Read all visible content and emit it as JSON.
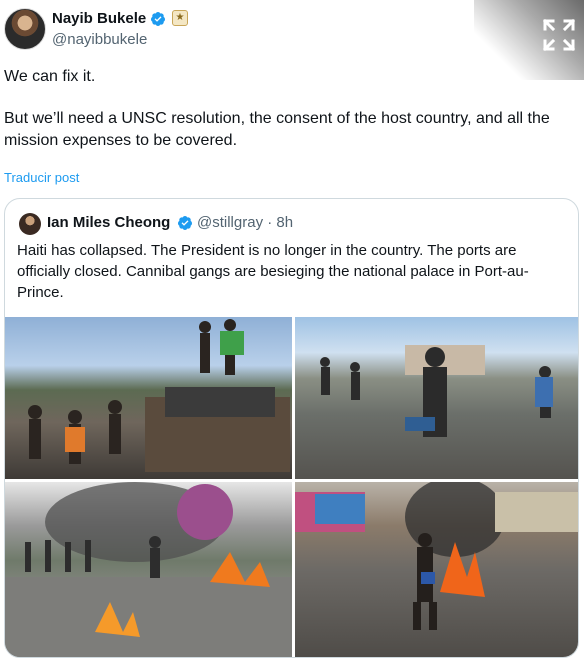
{
  "post": {
    "author_name": "Nayib Bukele",
    "author_handle": "@nayibbukele",
    "paragraph1": "We can fix it.",
    "paragraph2": "But we’ll need a UNSC resolution, the consent of the host country, and all the mission expenses to be covered.",
    "translate_label": "Traducir post"
  },
  "quoted": {
    "author_name": "Ian Miles Cheong",
    "author_handle": "@stillgray",
    "time": "· 8h",
    "text": "Haiti has collapsed. The President is no longer in the country. The ports are officially closed. Cannibal gangs are besieging the national palace in Port-au-Prince."
  },
  "icons": {
    "verified": "verified-badge-icon",
    "expand": "expand-icon",
    "affiliate": "affiliate-badge-icon"
  },
  "colors": {
    "link": "#1d9bf0",
    "verified": "#1d9bf0",
    "secondary_text": "#536471",
    "border": "#cfd9de"
  }
}
